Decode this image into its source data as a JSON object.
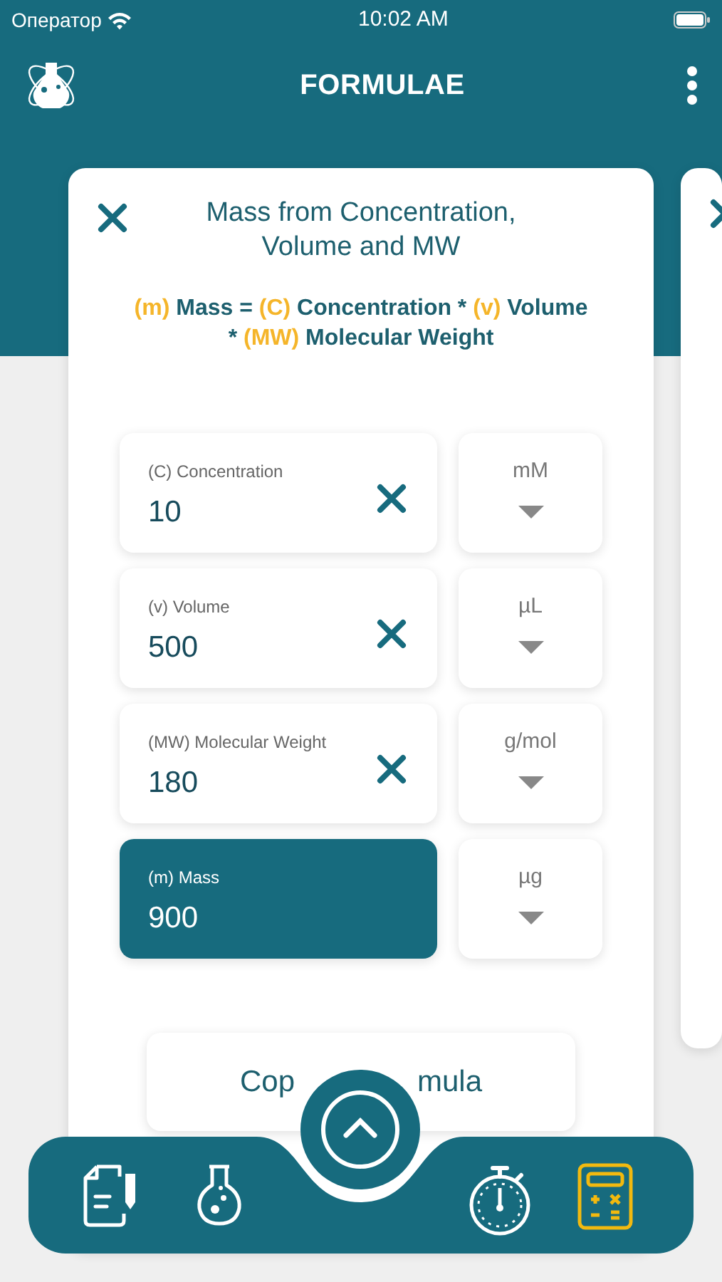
{
  "status_bar": {
    "carrier": "Оператор",
    "time": "10:02 AM"
  },
  "header": {
    "title": "FORMULAE"
  },
  "card": {
    "title": "Mass from Concentration, Volume and MW",
    "formula": [
      {
        "text": "(m)",
        "highlight": true
      },
      {
        "text": " Mass = ",
        "highlight": false
      },
      {
        "text": "(C)",
        "highlight": true
      },
      {
        "text": " Concentration * ",
        "highlight": false
      },
      {
        "text": "(v)",
        "highlight": true
      },
      {
        "text": " Volume * ",
        "highlight": false
      },
      {
        "text": "(MW)",
        "highlight": true
      },
      {
        "text": " Molecular Weight",
        "highlight": false
      }
    ],
    "fields": [
      {
        "kind": "input",
        "label": "(C) Concentration",
        "value": "10",
        "unit": "mM"
      },
      {
        "kind": "input",
        "label": "(v) Volume",
        "value": "500",
        "unit": "µL"
      },
      {
        "kind": "input",
        "label": "(MW) Molecular Weight",
        "value": "180",
        "unit": "g/mol"
      },
      {
        "kind": "result",
        "label": "(m) Mass",
        "value": "900",
        "unit": "µg"
      }
    ],
    "copy_button": {
      "text_before": "Cop",
      "text_after": "mula"
    }
  },
  "tab_bar": [
    {
      "kind": "notes",
      "selected": false
    },
    {
      "kind": "flask",
      "selected": false
    },
    {
      "kind": "stopwatch",
      "selected": false
    },
    {
      "kind": "calculator",
      "selected": true
    }
  ]
}
